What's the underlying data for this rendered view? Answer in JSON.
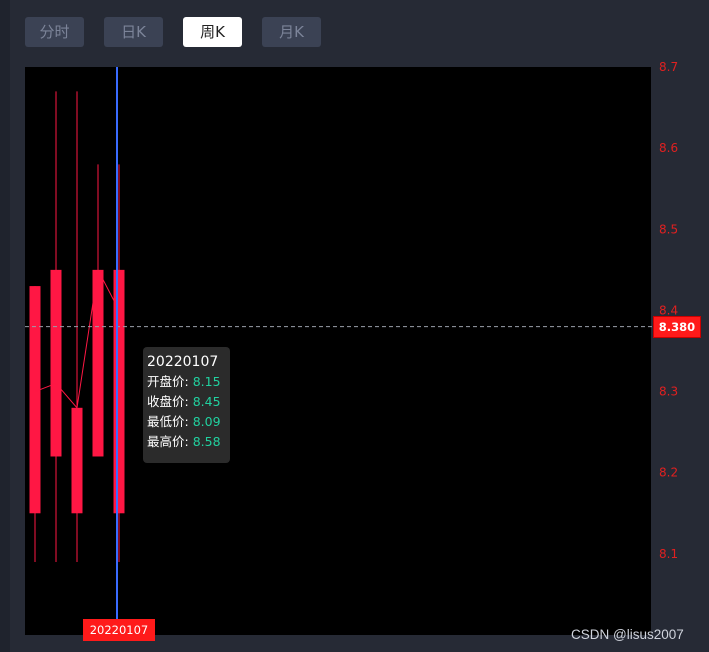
{
  "tabs": [
    {
      "label": "分时",
      "active": false
    },
    {
      "label": "日K",
      "active": false
    },
    {
      "label": "周K",
      "active": true
    },
    {
      "label": "月K",
      "active": false
    }
  ],
  "colors": {
    "up": "#ff1744",
    "axis_label": "#e02020",
    "crosshair": "#3a6cff",
    "price_line": "#9aa0aa",
    "tooltip_value": "#21d19f",
    "tag": "#ff1a1a"
  },
  "chart_data": {
    "type": "candlestick",
    "ylim": [
      8.0,
      8.7
    ],
    "y_ticks": [
      "8.1",
      "8.2",
      "8.3",
      "8.4",
      "8.5",
      "8.6",
      "8.7"
    ],
    "grid": false,
    "candles": [
      {
        "open": 8.15,
        "close": 8.43,
        "low": 8.09,
        "high": 8.43
      },
      {
        "open": 8.22,
        "close": 8.45,
        "low": 8.09,
        "high": 8.67
      },
      {
        "open": 8.15,
        "close": 8.28,
        "low": 8.09,
        "high": 8.67
      },
      {
        "open": 8.22,
        "close": 8.45,
        "low": 8.22,
        "high": 8.58
      },
      {
        "open": 8.15,
        "close": 8.45,
        "low": 8.09,
        "high": 8.58
      }
    ],
    "ma_line": [
      8.3,
      8.31,
      8.28,
      8.45,
      8.4
    ],
    "current_price": 8.38,
    "current_price_label": "8.380",
    "crosshair_index": 4,
    "crosshair_date": "20220107"
  },
  "tooltip": {
    "date": "20220107",
    "open_label": "开盘价: ",
    "open_value": "8.15",
    "close_label": "收盘价: ",
    "close_value": "8.45",
    "low_label": "最低价: ",
    "low_value": "8.09",
    "high_label": "最高价: ",
    "high_value": "8.58"
  },
  "watermark": "CSDN @lisus2007"
}
